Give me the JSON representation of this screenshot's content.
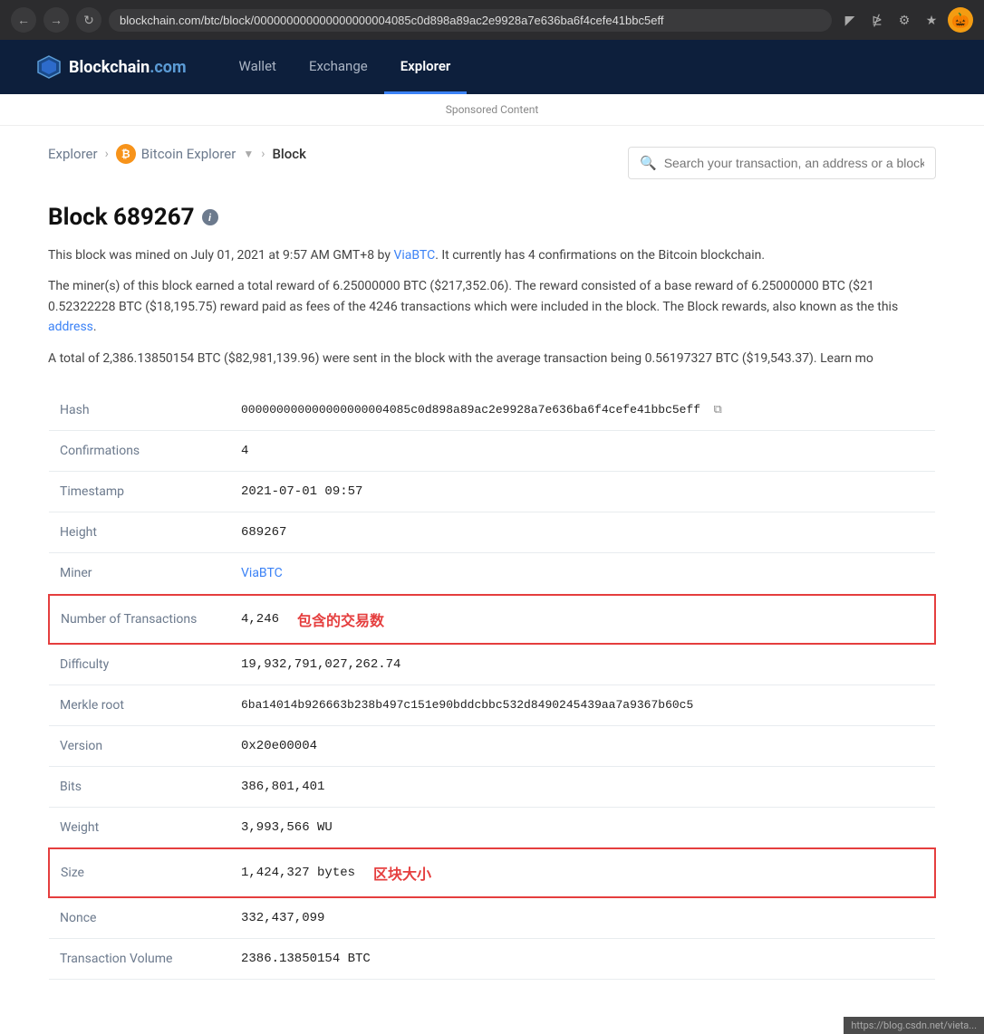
{
  "browser": {
    "url": "blockchain.com/btc/block/000000000000000000004085c0d898a89ac2e9928a7e636ba6f4cefe41bbc5eff",
    "avatar": "🎃"
  },
  "nav": {
    "logo_text": "Blockchain",
    "logo_com": ".com",
    "links": [
      {
        "label": "Wallet",
        "active": false
      },
      {
        "label": "Exchange",
        "active": false
      },
      {
        "label": "Explorer",
        "active": true
      }
    ]
  },
  "sponsored": "Sponsored Content",
  "breadcrumb": {
    "explorer": "Explorer",
    "bitcoin_explorer": "Bitcoin Explorer",
    "current": "Block"
  },
  "search": {
    "placeholder": "Search your transaction, an address or a block"
  },
  "block": {
    "title": "Block 689267",
    "description1": "This block was mined on July 01, 2021 at 9:57 AM GMT+8 by ViaBTC. It currently has 4 confirmations on the Bitcoin blockchain.",
    "description2": "The miner(s) of this block earned a total reward of 6.25000000 BTC ($217,352.06). The reward consisted of a base reward of 6.25000000 BTC ($21 0.52322228 BTC ($18,195.75) reward paid as fees of the 4246 transactions which were included in the block. The Block rewards, also known as the this address.",
    "description3": "A total of 2,386.13850154 BTC ($82,981,139.96) were sent in the block with the average transaction being 0.56197327 BTC ($19,543.37).  Learn mo"
  },
  "table": {
    "rows": [
      {
        "label": "Hash",
        "value": "000000000000000000004085c0d898a89ac2e9928a7e636ba6f4cefe41bbc5eff",
        "type": "hash",
        "copy": true
      },
      {
        "label": "Confirmations",
        "value": "4",
        "type": "text"
      },
      {
        "label": "Timestamp",
        "value": "2021-07-01 09:57",
        "type": "text"
      },
      {
        "label": "Height",
        "value": "689267",
        "type": "text"
      },
      {
        "label": "Miner",
        "value": "ViaBTC",
        "type": "link"
      },
      {
        "label": "Number of Transactions",
        "value": "4,246",
        "type": "text",
        "highlighted": true,
        "annotation": "包含的交易数"
      },
      {
        "label": "Difficulty",
        "value": "19,932,791,027,262.74",
        "type": "text"
      },
      {
        "label": "Merkle root",
        "value": "6ba14014b926663b238b497c151e90bddcbbc532d8490245439aa7a9367b60c5",
        "type": "hash"
      },
      {
        "label": "Version",
        "value": "0x20e00004",
        "type": "text"
      },
      {
        "label": "Bits",
        "value": "386,801,401",
        "type": "text"
      },
      {
        "label": "Weight",
        "value": "3,993,566 WU",
        "type": "text"
      },
      {
        "label": "Size",
        "value": "1,424,327 bytes",
        "type": "text",
        "highlighted": true,
        "annotation": "区块大小"
      },
      {
        "label": "Nonce",
        "value": "332,437,099",
        "type": "text"
      },
      {
        "label": "Transaction Volume",
        "value": "2386.13850154 BTC",
        "type": "text"
      }
    ]
  },
  "bottom_hint": "https://blog.csdn.net/vieta..."
}
